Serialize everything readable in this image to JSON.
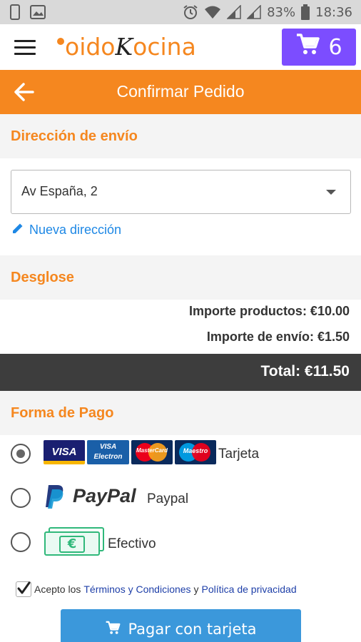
{
  "status_bar": {
    "battery_percent": "83%",
    "time": "18:36"
  },
  "app_bar": {
    "logo_part1": "oido",
    "logo_k": "K",
    "logo_part2": "ocina",
    "cart_count": "6"
  },
  "toolbar": {
    "title": "Confirmar Pedido"
  },
  "shipping": {
    "heading": "Dirección de envío",
    "selected_address": "Av España, 2",
    "new_address_link": "Nueva dirección"
  },
  "breakdown": {
    "heading": "Desglose",
    "products_amount": "Importe productos: €10.00",
    "shipping_amount": "Importe de envío: €1.50",
    "total": "Total: €11.50"
  },
  "payment": {
    "heading": "Forma de Pago",
    "card_brands": [
      "VISA",
      "VISA Electron",
      "MasterCard",
      "Maestro"
    ],
    "options": [
      {
        "label": "Tarjeta",
        "selected": true
      },
      {
        "label": "Paypal",
        "selected": false
      },
      {
        "label": "Efectivo",
        "selected": false
      }
    ],
    "paypal_logo": "PayPal",
    "cash_symbol": "€"
  },
  "terms": {
    "prefix": "Acepto los",
    "terms_link": "Términos y Condiciones",
    "conjunction": "y",
    "privacy_link": "Política de privacidad",
    "checked": true
  },
  "pay_button": {
    "label": "Pagar con tarjeta"
  },
  "colors": {
    "brand_orange": "#f5871f",
    "cart_purple": "#7c4dff",
    "pay_blue": "#3b98db",
    "link_blue": "#1e88e5"
  }
}
